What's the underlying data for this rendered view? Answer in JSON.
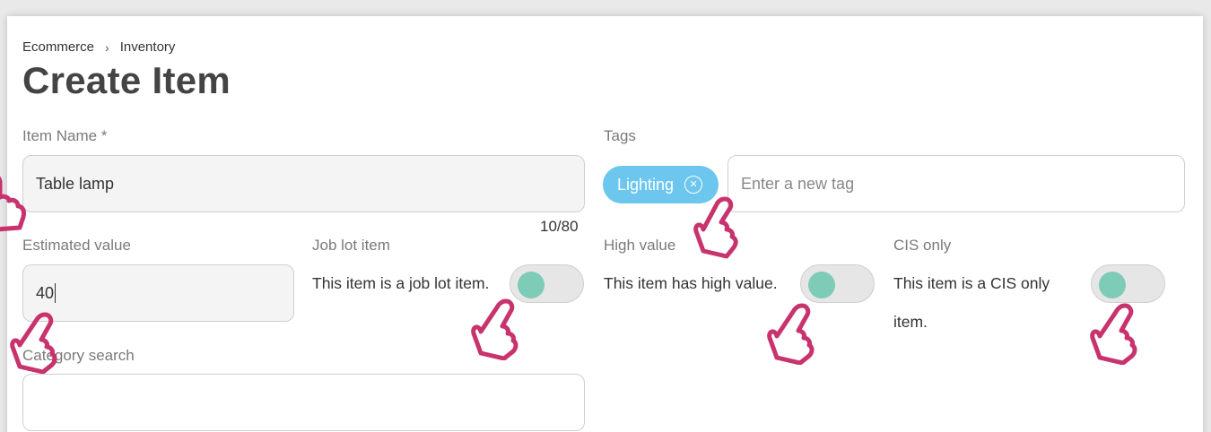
{
  "breadcrumb": {
    "items": [
      "Ecommerce",
      "Inventory"
    ],
    "separator": "›"
  },
  "page": {
    "title": "Create Item"
  },
  "form": {
    "item_name": {
      "label": "Item Name *",
      "value": "Table lamp",
      "counter": "10/80"
    },
    "tags": {
      "label": "Tags",
      "chips": [
        "Lighting"
      ],
      "placeholder": "Enter a new tag"
    },
    "estimated_value": {
      "label": "Estimated value",
      "value": "40"
    },
    "job_lot": {
      "label": "Job lot item",
      "description": "This item is a job lot item.",
      "enabled": false
    },
    "high_value": {
      "label": "High value",
      "description": "This item has high value.",
      "enabled": false
    },
    "cis_only": {
      "label": "CIS only",
      "description": "This item is a CIS only item.",
      "enabled": false
    },
    "category_search": {
      "label": "Category search",
      "value": ""
    }
  },
  "colors": {
    "tag_chip": "#6cc6ee",
    "toggle_knob": "#7ecbb7",
    "cursor_outline": "#c8336e"
  },
  "icons": [
    "chevron-right-icon",
    "close-circle-icon",
    "hand-pointer-icon"
  ]
}
